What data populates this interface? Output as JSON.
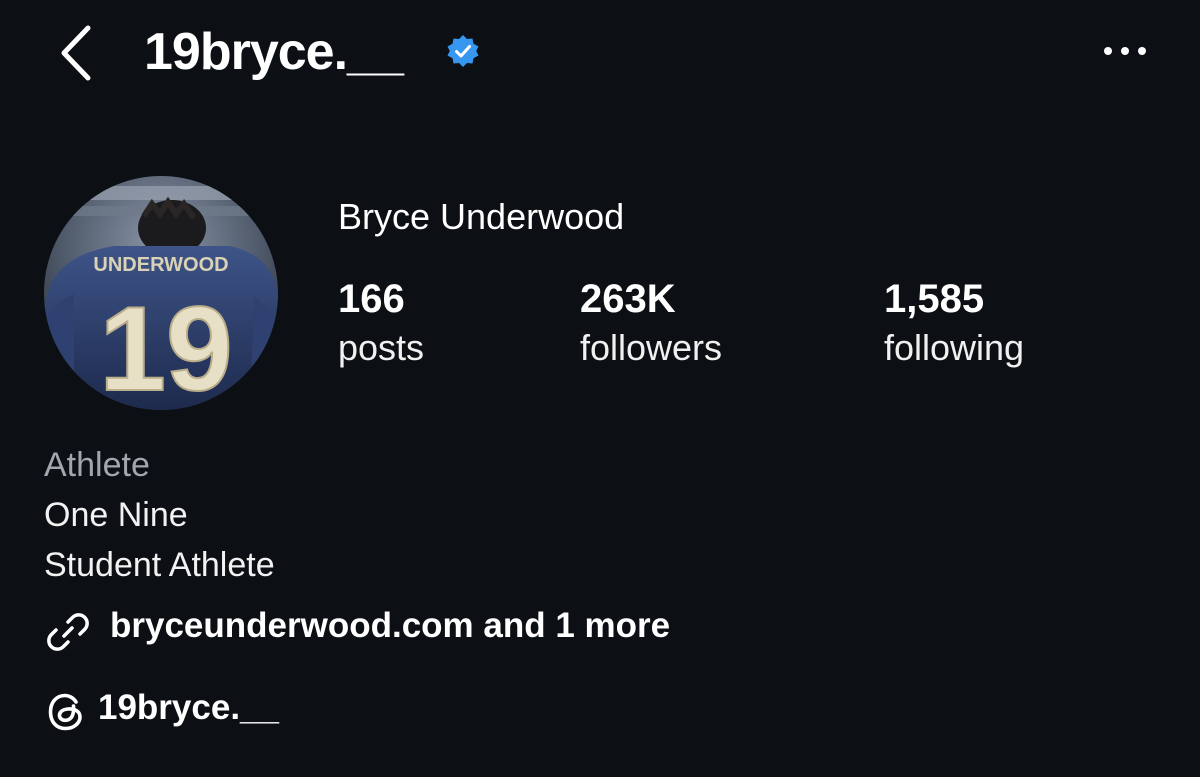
{
  "header": {
    "username": "19bryce.__",
    "verified_icon": "verified-badge-icon",
    "back_icon": "chevron-left-icon",
    "more_icon": "more-horizontal-icon"
  },
  "profile": {
    "avatar_jersey_name": "UNDERWOOD",
    "avatar_jersey_number": "19",
    "display_name": "Bryce Underwood",
    "stats": [
      {
        "value": "166",
        "label": "posts"
      },
      {
        "value": "263K",
        "label": "followers"
      },
      {
        "value": "1,585",
        "label": "following"
      }
    ]
  },
  "bio": {
    "category": "Athlete",
    "lines": [
      "One Nine",
      "Student Athlete"
    ],
    "link_text": "bryceunderwood.com and 1 more",
    "threads_handle": "19bryce.__"
  },
  "colors": {
    "background": "#0c0f14",
    "verified": "#3797f0",
    "category_text": "#a2a6ae"
  }
}
